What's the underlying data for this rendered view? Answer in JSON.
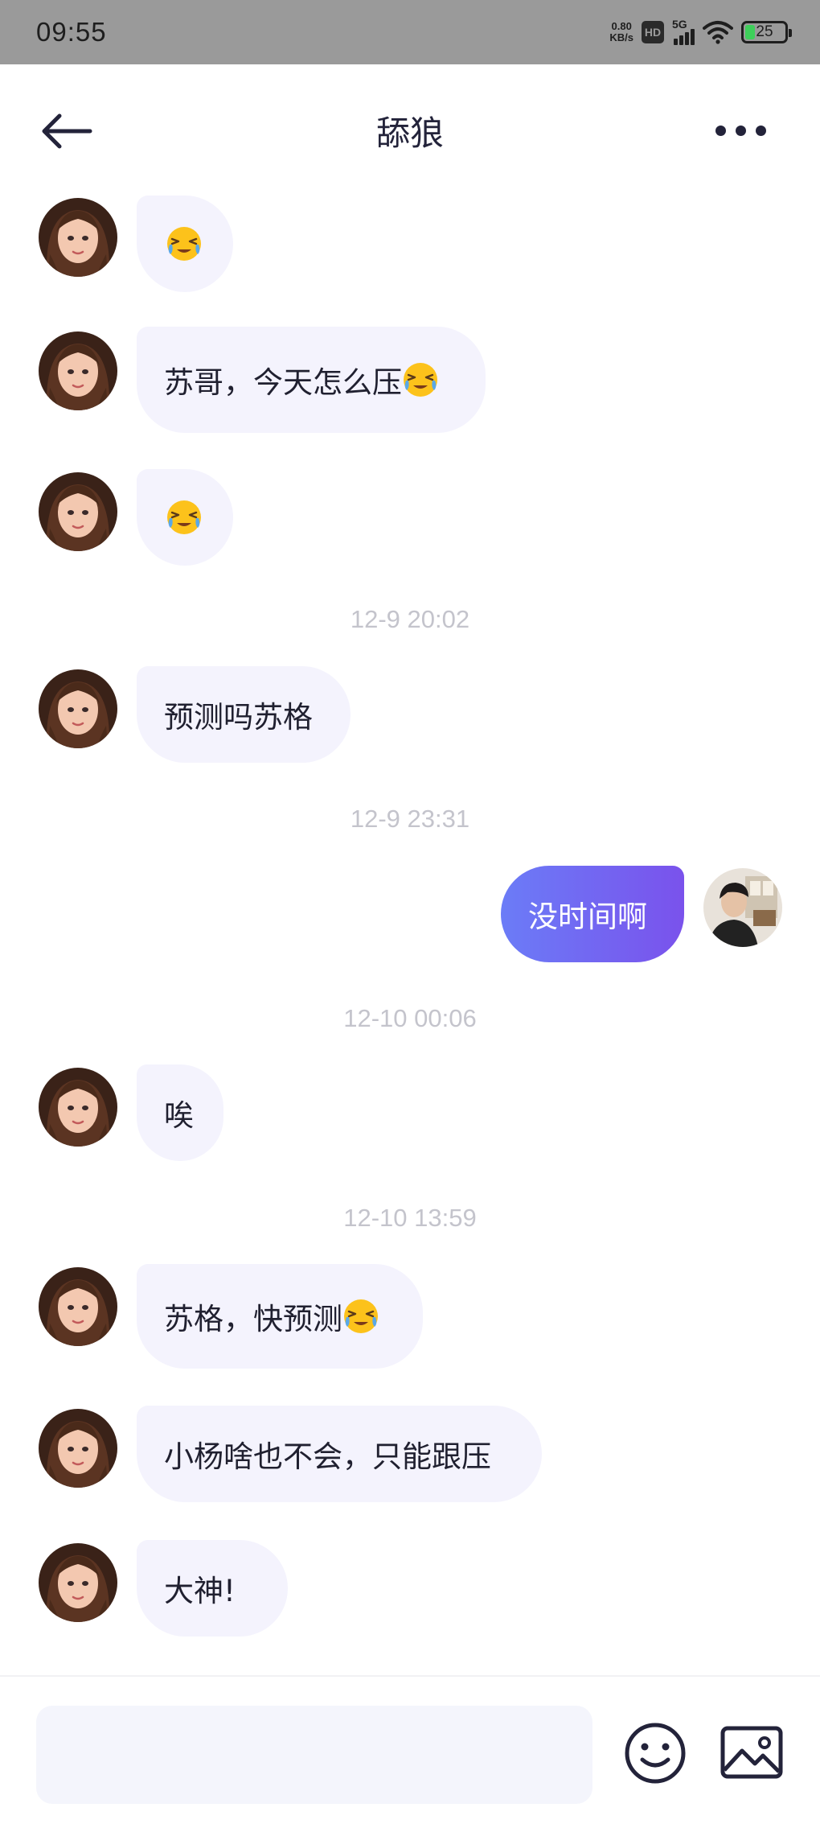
{
  "status_bar": {
    "time": "09:55",
    "net_speed_value": "0.80",
    "net_speed_unit": "KB/s",
    "hd_label": "HD",
    "network_label": "5G",
    "battery_level": "25",
    "battery_color": "#3ecf5a"
  },
  "header": {
    "title": "舔狼",
    "back_icon": "back-arrow-icon",
    "more_icon": "more-dots-icon"
  },
  "messages": [
    {
      "side": "left",
      "text": ""
    },
    {
      "side": "left",
      "text": "苏哥，今天怎么压"
    },
    {
      "side": "left",
      "text": ""
    },
    {
      "timestamp": "12-9 20:02"
    },
    {
      "side": "left",
      "text": "预测吗苏格"
    },
    {
      "timestamp": "12-9 23:31"
    },
    {
      "side": "right",
      "text": "没时间啊"
    },
    {
      "timestamp": "12-10 00:06"
    },
    {
      "side": "left",
      "text": "唉"
    },
    {
      "timestamp": "12-10 13:59"
    },
    {
      "side": "left",
      "text": "苏格，快预测"
    },
    {
      "side": "left",
      "text": "小杨啥也不会，只能跟压"
    },
    {
      "side": "left",
      "text": "大神!"
    }
  ],
  "input_bar": {
    "placeholder": "",
    "emoji_icon": "smiley-face-icon",
    "image_icon": "image-picture-icon"
  },
  "colors": {
    "incoming_bubble": "#f4f3fd",
    "outgoing_bubble_start": "#6b7cf7",
    "outgoing_bubble_end": "#7a52ec",
    "timestamp": "#c4c4cc",
    "status_bar_bg": "#9a9a9a"
  }
}
